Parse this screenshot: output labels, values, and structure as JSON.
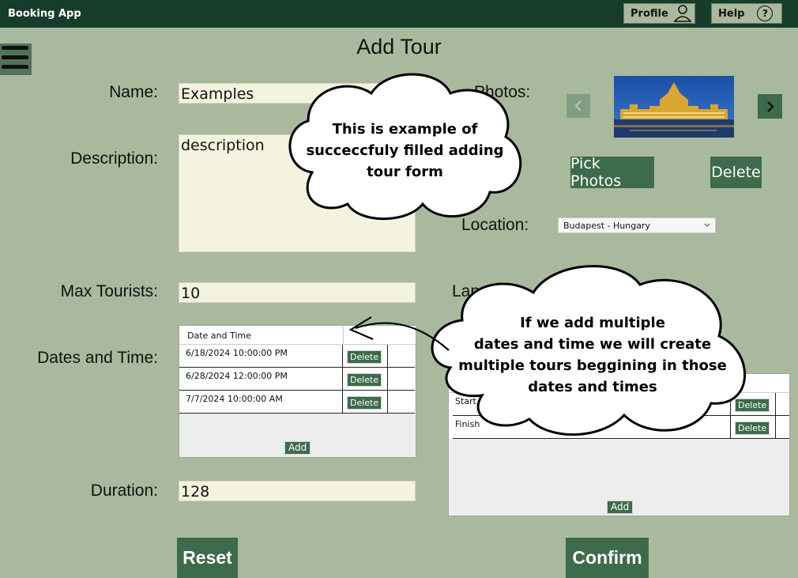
{
  "header": {
    "app_title": "Booking App",
    "profile_label": "Profile",
    "help_label": "Help",
    "help_icon": "?"
  },
  "page": {
    "title": "Add Tour"
  },
  "form": {
    "name_label": "Name:",
    "name_value": "Examples",
    "description_label": "Description:",
    "description_value": "description",
    "max_tourists_label": "Max Tourists:",
    "max_tourists_value": "10",
    "dates_label": "Dates and Time:",
    "dates_grid": {
      "header": "Date and Time",
      "rows": [
        "6/18/2024 10:00:00 PM",
        "6/28/2024 12:00:00 PM",
        "7/7/2024 10:00:00 AM"
      ],
      "delete_label": "Delete",
      "add_label": "Add"
    },
    "duration_label": "Duration:",
    "duration_value": "128",
    "photos_label": "Photos:",
    "pick_photos_label": "Pick Photos",
    "delete_photo_label": "Delete",
    "location_label": "Location:",
    "location_value": "Budapest - Hungary",
    "language_label": "Lang",
    "checkpoints_grid": {
      "rows": [
        "Start",
        "Finish"
      ],
      "delete_label": "Delete",
      "add_label": "Add"
    },
    "reset_label": "Reset",
    "confirm_label": "Confirm"
  },
  "callouts": {
    "top": "This is example of\nsucceccfuly filled adding\ntour form",
    "bottom": "If we add multiple\ndates and time we will create\nmultiple tours beggining in those\ndates and times"
  },
  "colors": {
    "background": "#a9b99d",
    "topbar": "#163c2c",
    "button": "#3d6b4c",
    "field": "#f3f3df"
  }
}
